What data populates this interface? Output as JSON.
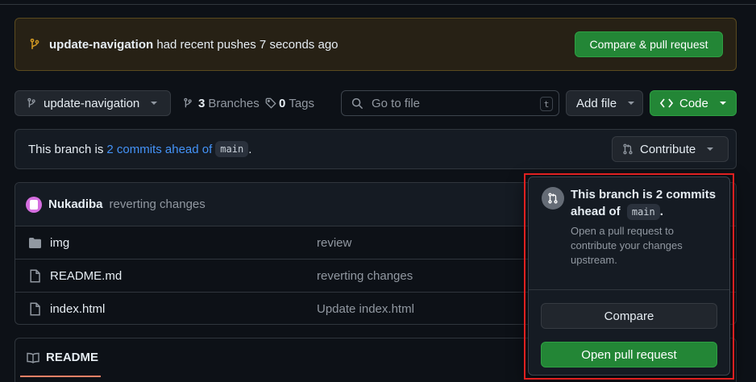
{
  "flash": {
    "branch": "update-navigation",
    "message": "had recent pushes 7 seconds ago",
    "compare_label": "Compare & pull request"
  },
  "toolbar": {
    "branch_selector": "update-navigation",
    "branches_count": "3",
    "branches_label": "Branches",
    "tags_count": "0",
    "tags_label": "Tags",
    "search_placeholder": "Go to file",
    "search_shortcut": "t",
    "add_file_label": "Add file",
    "code_label": "Code"
  },
  "ahead_bar": {
    "prefix": "This branch is",
    "link": "2 commits ahead of",
    "base_branch": "main",
    "suffix": ".",
    "contribute_label": "Contribute"
  },
  "latest_commit": {
    "author": "Nukadiba",
    "message": "reverting changes"
  },
  "files": [
    {
      "name": "img",
      "type": "folder",
      "commit_message": "review"
    },
    {
      "name": "README.md",
      "type": "file",
      "commit_message": "reverting changes"
    },
    {
      "name": "index.html",
      "type": "file",
      "commit_message": "Update index.html"
    }
  ],
  "readme_tab": {
    "label": "README"
  },
  "contribute_popover": {
    "title_prefix": "This branch is 2 commits ahead of",
    "base_branch": "main",
    "title_suffix": ".",
    "description": "Open a pull request to contribute your changes upstream.",
    "compare_label": "Compare",
    "open_pr_label": "Open pull request"
  },
  "colors": {
    "background": "#0d1117",
    "primary_button": "#238636",
    "link": "#4493f8",
    "flash_background": "#272115",
    "highlight": "#e02020"
  }
}
